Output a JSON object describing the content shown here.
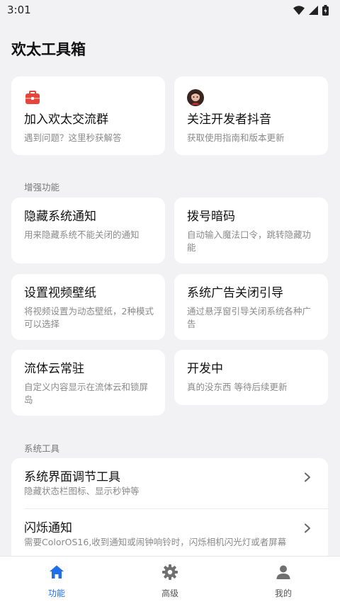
{
  "status": {
    "time": "3:01"
  },
  "app": {
    "title": "欢太工具箱"
  },
  "top_cards": [
    {
      "title": "加入欢太交流群",
      "desc": "遇到问题？这里秒获解答",
      "icon": "briefcase-icon"
    },
    {
      "title": "关注开发者抖音",
      "desc": "获取使用指南和版本更新",
      "icon": "avatar-icon"
    }
  ],
  "enhanced": {
    "label": "增强功能",
    "cards": [
      {
        "title": "隐藏系统通知",
        "desc": "用来隐藏系统不能关闭的通知"
      },
      {
        "title": "拨号暗码",
        "desc": "自动输入魔法口令，跳转隐藏功能"
      },
      {
        "title": "设置视频壁纸",
        "desc": "将视频设置为动态壁纸，2种模式可以选择"
      },
      {
        "title": "系统广告关闭引导",
        "desc": "通过悬浮窗引导关闭系统各种广告"
      },
      {
        "title": "流体云常驻",
        "desc": "自定义内容显示在流体云和锁屏岛"
      },
      {
        "title": "开发中",
        "desc": "真的没东西 等待后续更新"
      }
    ]
  },
  "system_tools": {
    "label": "系统工具",
    "items": [
      {
        "title": "系统界面调节工具",
        "desc": "隐藏状态栏图标、显示秒钟等"
      },
      {
        "title": "闪烁通知",
        "desc": "需要ColorOS16,收到通知或闹钟响铃时，闪烁相机闪光灯或者屏幕"
      }
    ]
  },
  "nav": [
    {
      "label": "功能",
      "icon": "home-icon",
      "active": true
    },
    {
      "label": "高级",
      "icon": "gear-icon",
      "active": false
    },
    {
      "label": "我的",
      "icon": "person-icon",
      "active": false
    }
  ],
  "colors": {
    "accent": "#1e6fe8",
    "background": "#f2f2f5",
    "card": "#ffffff",
    "briefcase": "#e5453b"
  }
}
